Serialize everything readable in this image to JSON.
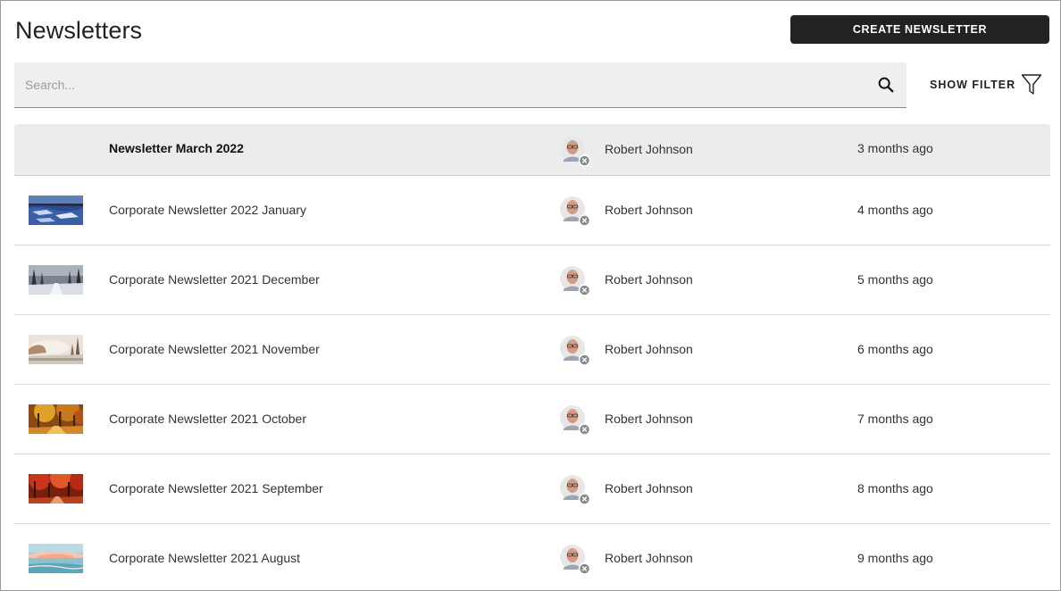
{
  "header": {
    "title": "Newsletters",
    "create_label": "CREATE NEWSLETTER"
  },
  "search": {
    "placeholder": "Search...",
    "value": "",
    "icon": "search-icon"
  },
  "filter": {
    "label": "SHOW FILTER",
    "icon": "filter-icon"
  },
  "newsletters": [
    {
      "title": "Newsletter March 2022",
      "author": "Robert Johnson",
      "time": "3 months ago",
      "thumbnail": "none",
      "selected": true
    },
    {
      "title": "Corporate Newsletter 2022 January",
      "author": "Robert Johnson",
      "time": "4 months ago",
      "thumbnail": "frozen-lake"
    },
    {
      "title": "Corporate Newsletter 2021 December",
      "author": "Robert Johnson",
      "time": "5 months ago",
      "thumbnail": "snowy-forest-road"
    },
    {
      "title": "Corporate Newsletter 2021 November",
      "author": "Robert Johnson",
      "time": "6 months ago",
      "thumbnail": "misty-lake"
    },
    {
      "title": "Corporate Newsletter 2021 October",
      "author": "Robert Johnson",
      "time": "7 months ago",
      "thumbnail": "autumn-forest"
    },
    {
      "title": "Corporate Newsletter 2021 September",
      "author": "Robert Johnson",
      "time": "8 months ago",
      "thumbnail": "red-autumn-trees"
    },
    {
      "title": "Corporate Newsletter 2021 August",
      "author": "Robert Johnson",
      "time": "9 months ago",
      "thumbnail": "beach-sunset"
    }
  ],
  "colors": {
    "primary_button": "#222222",
    "selected_row": "#ececec",
    "search_bg": "#efefef"
  }
}
